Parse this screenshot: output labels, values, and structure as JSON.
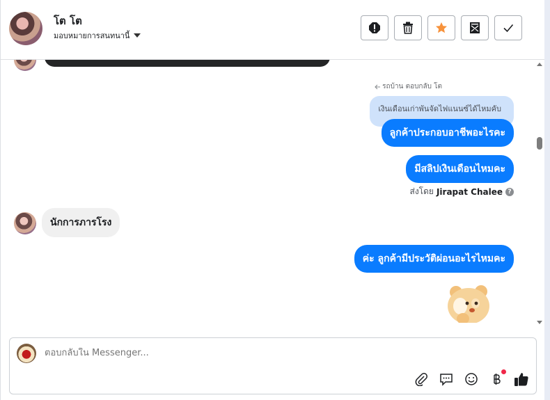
{
  "header": {
    "name": "โต โต",
    "assign_label": "มอบหมายการสนทนานี้",
    "actions": [
      {
        "name": "report-spam-button",
        "icon": "alert-icon"
      },
      {
        "name": "delete-button",
        "icon": "trash-icon"
      },
      {
        "name": "star-button",
        "icon": "star-icon",
        "color": "#f7923b"
      },
      {
        "name": "mark-unread-button",
        "icon": "envelope-icon"
      },
      {
        "name": "mark-done-button",
        "icon": "check-icon"
      }
    ]
  },
  "thread": {
    "reply_context": "รถบ้าน ตอบกลับ โต",
    "quoted_text": "เงินเดือนเก่าพันจัดไฟแนนซ์ได้ไหมคับ",
    "messages_out_1": "ลูกค้าประกอบอาชีพอะไรคะ",
    "messages_out_2": "มีสลิปเงินเดือนไหมคะ",
    "sent_by_prefix": "ส่งโดย",
    "sent_by_name": "Jirapat Chalee",
    "message_in": "นักการภารโรง",
    "messages_out_3": "ค่ะ ลูกค้ามีประวัติผ่อนอะไรไหมคะ"
  },
  "composer": {
    "placeholder": "ตอบกลับใน Messenger...",
    "tools": [
      "attach-icon",
      "saved-reply-icon",
      "emoji-icon",
      "payment-icon",
      "like-icon"
    ]
  },
  "colors": {
    "outgoing_bubble": "#0a7cff",
    "incoming_bubble": "#f0f0f0",
    "quote_bubble": "#cfe2fb",
    "star": "#f7923b"
  }
}
